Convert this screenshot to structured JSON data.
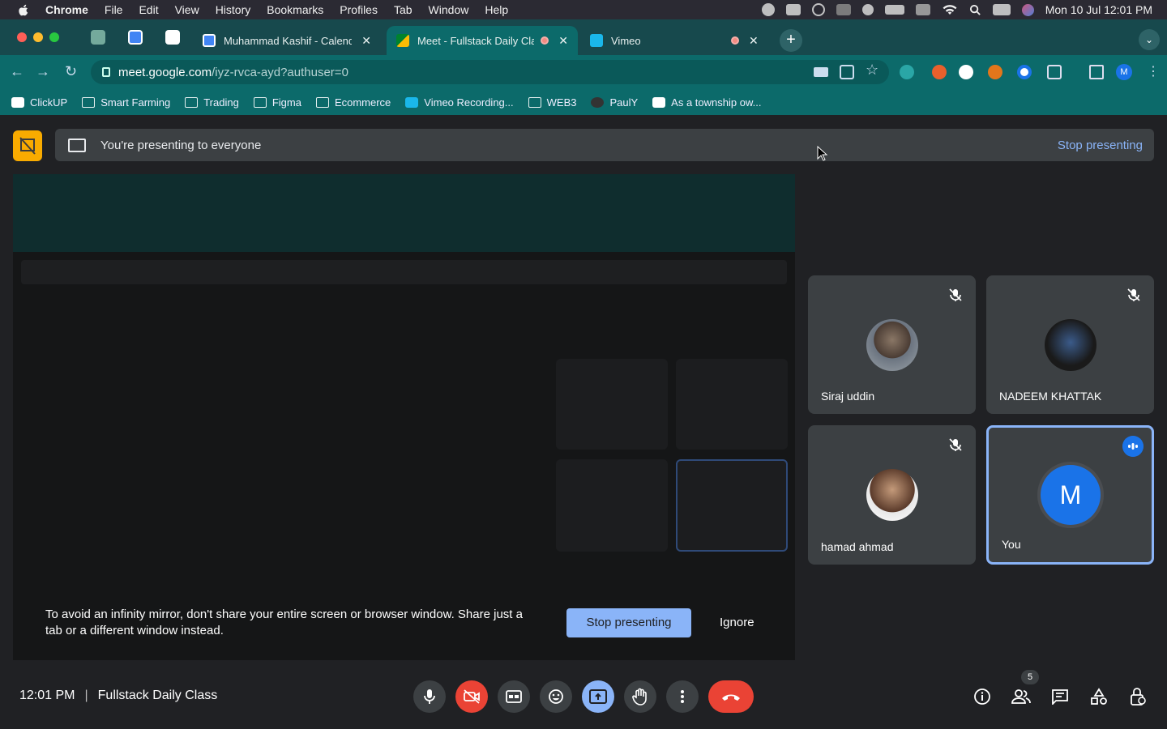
{
  "menubar": {
    "app": "Chrome",
    "items": [
      "File",
      "Edit",
      "View",
      "History",
      "Bookmarks",
      "Profiles",
      "Tab",
      "Window",
      "Help"
    ],
    "clock": "Mon 10 Jul  12:01 PM"
  },
  "tabs": [
    {
      "title": "Muhammad Kashif - Calendar",
      "favicon": "calendar-icon",
      "active": false
    },
    {
      "title": "Meet - Fullstack Daily Class",
      "favicon": "meet-icon",
      "active": true
    },
    {
      "title": "Vimeo",
      "favicon": "vimeo-icon",
      "active": false
    }
  ],
  "omnibox": {
    "host": "meet.google.com",
    "path": "/iyz-rvca-ayd?authuser=0"
  },
  "profile_initial": "M",
  "bookmarks": [
    "ClickUP",
    "Smart Farming",
    "Trading",
    "Figma",
    "Ecommerce",
    "Vimeo Recording...",
    "WEB3",
    "PaulY",
    "As a township ow..."
  ],
  "banner": {
    "text": "You're presenting to everyone",
    "stop": "Stop presenting"
  },
  "participants": [
    {
      "name": "Siraj uddin",
      "muted": true
    },
    {
      "name": "NADEEM KHATTAK",
      "muted": true
    },
    {
      "name": "hamad ahmad",
      "muted": true
    },
    {
      "name": "You",
      "initial": "M",
      "speaking": true
    }
  ],
  "popup": {
    "text": "To avoid an infinity mirror, don't share your entire screen or browser window. Share just a tab or a different window instead.",
    "stop": "Stop presenting",
    "ignore": "Ignore"
  },
  "footer": {
    "time": "12:01 PM",
    "meeting": "Fullstack Daily Class",
    "participant_count": "5"
  },
  "colors": {
    "accent": "#8ab4f8",
    "danger": "#ea4335",
    "present": "#f9ab00",
    "chrome_toolbar": "#0c6a6a"
  }
}
